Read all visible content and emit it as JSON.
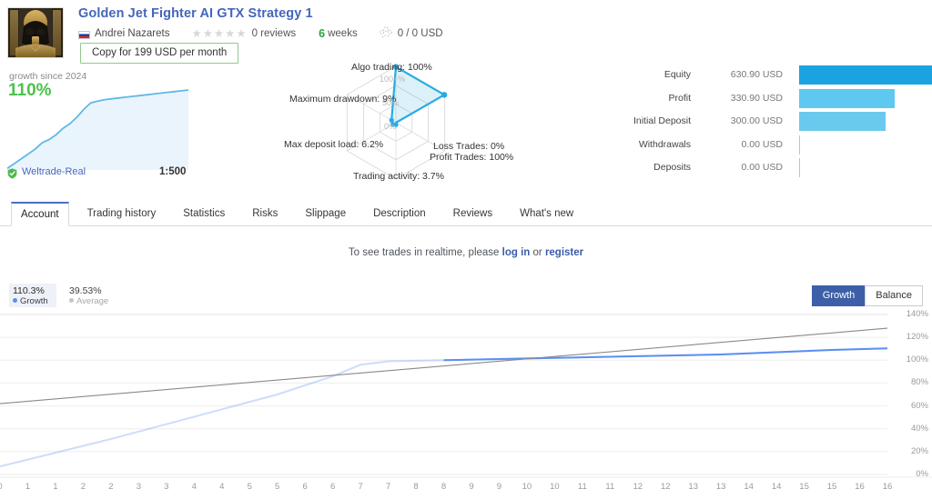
{
  "header": {
    "title": "Golden Jet Fighter AI GTX Strategy 1",
    "author": "Andrei Nazarets",
    "reviews": "0 reviews",
    "weeks_number": "6",
    "weeks_label": "weeks",
    "subscribers": "0 / 0 USD",
    "copy_button": "Copy for 199 USD per month",
    "stars_count": 5,
    "avatar_name": "avatar-image",
    "flag_name": "russia-flag-icon"
  },
  "growth_panel": {
    "caption": "growth since 2024",
    "value": "110%",
    "broker": "Weltrade-Real",
    "leverage": "1:500",
    "sparkline": [
      2,
      8,
      14,
      20,
      26,
      34,
      38,
      44,
      52,
      58,
      66,
      76,
      84,
      86,
      88,
      89,
      90,
      91,
      92,
      93,
      94,
      95,
      96,
      97,
      98,
      99,
      100
    ]
  },
  "radar": {
    "rings": [
      "100+%",
      "50%",
      "0%"
    ],
    "axes": [
      {
        "label": "Algo trading: 100%",
        "value": 100
      },
      {
        "label": "Profit Trades: 100%",
        "value": 100
      },
      {
        "label": "Loss Trades: 0%",
        "value": 0
      },
      {
        "label": "Trading activity: 3.7%",
        "value": 3.7
      },
      {
        "label": "Max deposit load: 6.2%",
        "value": 6.2
      },
      {
        "label": "Maximum drawdown: 9%",
        "value": 9
      }
    ],
    "accent": "#29abe2"
  },
  "stats": {
    "rows": [
      {
        "name": "Equity",
        "value": "630.90 USD",
        "amount": 630.9,
        "color": "#1aa3e0"
      },
      {
        "name": "Profit",
        "value": "330.90 USD",
        "amount": 330.9,
        "color": "#5fc8f0"
      },
      {
        "name": "Initial Deposit",
        "value": "300.00 USD",
        "amount": 300.0,
        "color": "#6cc9ee"
      },
      {
        "name": "Withdrawals",
        "value": "0.00 USD",
        "amount": 0,
        "color": "#8fd3f2"
      },
      {
        "name": "Deposits",
        "value": "0.00 USD",
        "amount": 0,
        "color": "#8fd3f2"
      }
    ],
    "max": 630.9
  },
  "tabs": [
    {
      "label": "Account",
      "active": true
    },
    {
      "label": "Trading history",
      "active": false
    },
    {
      "label": "Statistics",
      "active": false
    },
    {
      "label": "Risks",
      "active": false
    },
    {
      "label": "Slippage",
      "active": false
    },
    {
      "label": "Description",
      "active": false
    },
    {
      "label": "Reviews",
      "active": false
    },
    {
      "label": "What's new",
      "active": false
    }
  ],
  "notice": {
    "prefix": "To see trades in realtime, please ",
    "login": "log in",
    "middle": " or ",
    "register": "register"
  },
  "chart_legend": {
    "growth_value": "110.3%",
    "growth_name": "Growth",
    "growth_color": "#5b8ff0",
    "average_value": "39.53%",
    "average_name": "Average",
    "average_color": "#b8b8b8"
  },
  "chart_toggle": {
    "growth": "Growth",
    "balance": "Balance",
    "selected": "Growth"
  },
  "chart_data": {
    "type": "line",
    "title": "",
    "xlabel": "",
    "ylabel": "",
    "ylim": [
      0,
      140
    ],
    "yticks": [
      "0%",
      "20%",
      "40%",
      "60%",
      "80%",
      "100%",
      "120%",
      "140%"
    ],
    "grid": true,
    "legend_position": "top-left",
    "xticks": [
      "0",
      "1",
      "1",
      "2",
      "2",
      "3",
      "3",
      "4",
      "4",
      "5",
      "5",
      "6",
      "6",
      "7",
      "7",
      "8",
      "8",
      "9",
      "9",
      "10",
      "10",
      "11",
      "11",
      "12",
      "12",
      "13",
      "13",
      "14",
      "14",
      "15",
      "15",
      "16",
      "16"
    ],
    "series": [
      {
        "name": "Growth",
        "color": "#5b8ff0",
        "x": [
          0,
          1,
          2,
          3,
          4,
          5,
          6,
          6.5,
          7,
          8,
          9,
          10,
          11,
          12,
          13,
          14,
          15,
          16
        ],
        "values": [
          7,
          19,
          31,
          44,
          57,
          70,
          86,
          96,
          99,
          100,
          101,
          102,
          103,
          104,
          105,
          107,
          109,
          110.3
        ]
      },
      {
        "name": "Average",
        "color": "#8a8a8a",
        "x": [
          0,
          16
        ],
        "values": [
          62,
          128
        ]
      }
    ]
  }
}
